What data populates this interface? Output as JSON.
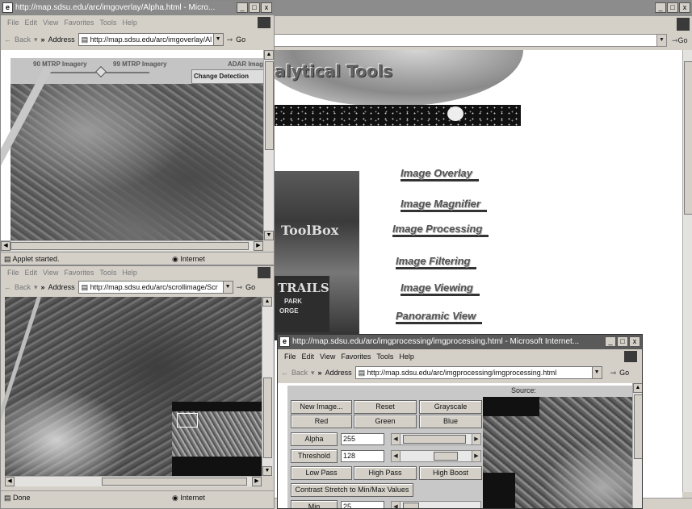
{
  "bg_window": {
    "controls": [
      "_",
      "ɦ",
      "x"
    ],
    "page_heading": "alytical Tools",
    "toolbox_label": "ToolBox",
    "sign_text": "TRAILS",
    "sign_sub": "PARK",
    "sign_sub2": "ORGE",
    "nav_links": [
      "Image Overlay",
      "Image Magnifier",
      "Image Processing",
      "Image Filtering",
      "Image Viewing",
      "Panoramic View"
    ],
    "go_label": "Go"
  },
  "win1": {
    "title": "http://map.sdsu.edu/arc/imgoverlay/Alpha.html - Micro...",
    "menus": [
      "File",
      "Edit",
      "View",
      "Favorites",
      "Tools",
      "Help"
    ],
    "back_label": "Back",
    "address_label": "Address",
    "address_url": "http://map.sdsu.edu/arc/imgoverlay/Al",
    "go_label": "Go",
    "applet": {
      "label_left": "90 MTRP Imagery",
      "label_mid": "99 MTRP Imagery",
      "label_right": "ADAR Imag",
      "change_detection": "Change Detection",
      "slider_value": 0.55
    },
    "status_text": "Applet started.",
    "zone_text": "Internet"
  },
  "win2": {
    "menus": [
      "File",
      "Edit",
      "View",
      "Favorites",
      "Tools",
      "Help"
    ],
    "back_label": "Back",
    "address_label": "Address",
    "address_url": "http://map.sdsu.edu/arc/scrollimage/Scr",
    "go_label": "Go",
    "status_text": "Done",
    "zone_text": "Internet"
  },
  "win3": {
    "title": "http://map.sdsu.edu/arc/imgprocessing/imgprocessing.html - Microsoft Internet...",
    "menus": [
      "File",
      "Edit",
      "View",
      "Favorites",
      "Tools",
      "Help"
    ],
    "back_label": "Back",
    "address_label": "Address",
    "address_url": "http://map.sdsu.edu/arc/imgprocessing/imgprocessing.html",
    "go_label": "Go",
    "source_label": "Source:",
    "buttons": {
      "new_image": "New Image...",
      "reset": "Reset",
      "grayscale": "Grayscale",
      "red": "Red",
      "green": "Green",
      "blue": "Blue",
      "alpha": "Alpha",
      "threshold": "Threshold",
      "low_pass": "Low Pass",
      "high_pass": "High Pass",
      "high_boost": "High Boost",
      "contrast": "Contrast Stretch to Min/Max Values",
      "min": "Min"
    },
    "alpha_value": "255",
    "threshold_value": "128",
    "min_value": "25"
  }
}
